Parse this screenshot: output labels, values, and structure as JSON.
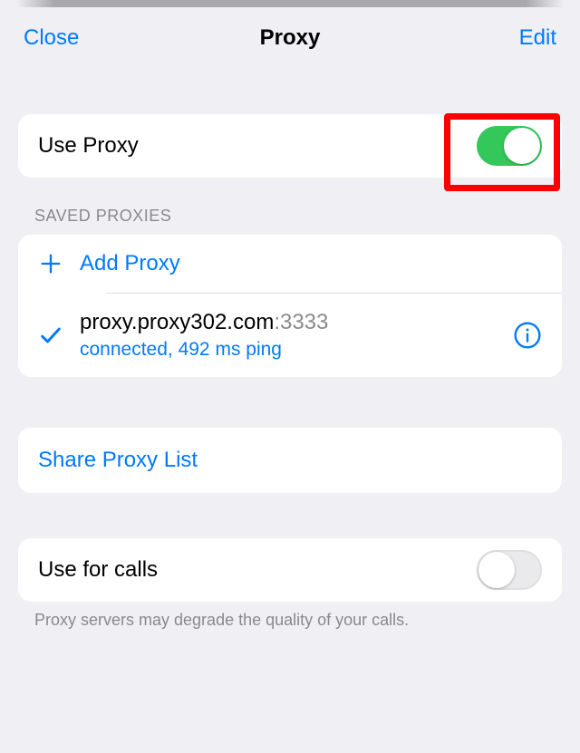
{
  "nav": {
    "close": "Close",
    "title": "Proxy",
    "edit": "Edit"
  },
  "use_proxy": {
    "label": "Use Proxy",
    "on": true
  },
  "saved_proxies": {
    "header": "SAVED PROXIES",
    "add_label": "Add Proxy",
    "items": [
      {
        "host": "proxy.proxy302.com",
        "port": ":3333",
        "status": "connected, 492 ms ping",
        "selected": true
      }
    ]
  },
  "share": {
    "label": "Share Proxy List"
  },
  "calls": {
    "label": "Use for calls",
    "on": false,
    "footer": "Proxy servers may degrade the quality of your calls."
  }
}
